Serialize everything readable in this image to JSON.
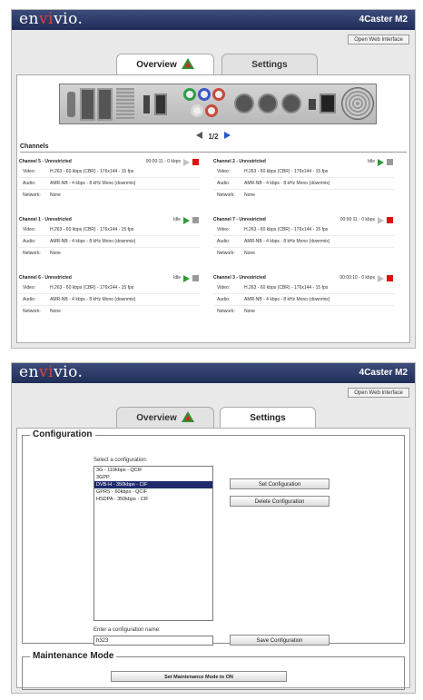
{
  "brand": {
    "name_a": "en",
    "name_b": "vi",
    "name_c": "vio",
    "product": "4Caster M2"
  },
  "header": {
    "open_web_interface": "Open Web Interface"
  },
  "tabs": {
    "overview": "Overview",
    "settings": "Settings"
  },
  "pager": {
    "label": "1/2"
  },
  "channels": {
    "title": "Channels",
    "row_labels": {
      "video": "Video:",
      "audio": "Audio:",
      "network": "Network:"
    },
    "items": [
      {
        "name": "Channel 5 - Unrestricted",
        "status": "00:00:11 - 0 kbps",
        "running": true,
        "video": "H.263 - 60 kbps (CBR) - 176x144 - 15 fps",
        "audio": "AMR-NB - 4 kbps - 8 kHz Mono (downmix)",
        "network": "None"
      },
      {
        "name": "Channel 2 - Unrestricted",
        "status": "Idle",
        "running": false,
        "video": "H.263 - 60 kbps (CBR) - 176x144 - 15 fps",
        "audio": "AMR-NB - 4 kbps - 8 kHz Mono (downmix)",
        "network": "None"
      },
      {
        "name": "Channel 1 - Unrestricted",
        "status": "Idle",
        "running": false,
        "video": "H.263 - 60 kbps (CBR) - 176x144 - 15 fps",
        "audio": "AMR-NB - 4 kbps - 8 kHz Mono (downmix)",
        "network": "None"
      },
      {
        "name": "Channel 7 - Unrestricted",
        "status": "00:00:11 - 0 kbps",
        "running": true,
        "video": "H.263 - 60 kbps (CBR) - 176x144 - 15 fps",
        "audio": "AMR-NB - 4 kbps - 8 kHz Mono (downmix)",
        "network": "None"
      },
      {
        "name": "Channel 6 - Unrestricted",
        "status": "Idle",
        "running": false,
        "video": "H.263 - 60 kbps (CBR) - 176x144 - 15 fps",
        "audio": "AMR-NB - 4 kbps - 8 kHz Mono (downmix)",
        "network": "None"
      },
      {
        "name": "Channel 3 - Unrestricted",
        "status": "00:00:10 - 0 kbps",
        "running": true,
        "video": "H.263 - 60 kbps (CBR) - 176x144 - 15 fps",
        "audio": "AMR-NB - 4 kbps - 8 kHz Mono (downmix)",
        "network": "None"
      }
    ]
  },
  "settings": {
    "configuration_legend": "Configuration",
    "select_label": "Select a configuration:",
    "options": [
      "3G - 110kbps - QCIF",
      "3GPP",
      "DVB-H - 350kbps - CIF",
      "GPRS - 60kbps - QCIF",
      "HSDPA - 350kbps - CIF"
    ],
    "selected_option": "DVB-H - 350kbps - CIF",
    "set_configuration": "Set Configuration",
    "delete_configuration": "Delete Configuration",
    "name_label": "Enter a configuration name:",
    "name_value": "h323",
    "save_configuration": "Save Configuration",
    "maintenance_legend": "Maintenance Mode",
    "maintenance_button": "Set Maintenance Mode to ON"
  },
  "colors": {
    "titlebar": "#2b3a68",
    "selected": "#1f2a6b",
    "play_active": "#c0c0c0",
    "play_idle": "#2f9a3a",
    "stop_active": "#e01010",
    "stop_idle": "#9a9a9a"
  }
}
